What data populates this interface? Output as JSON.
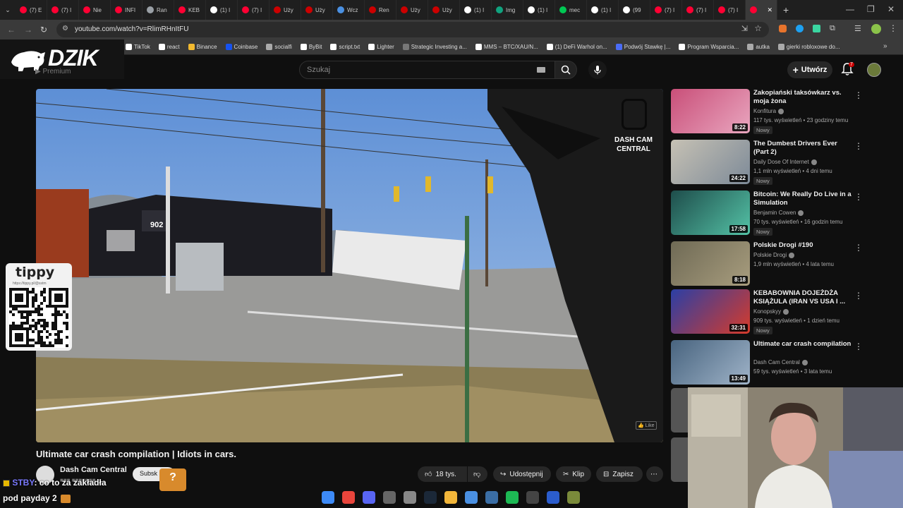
{
  "tabs": [
    {
      "label": "(7) E",
      "color": "#ff0033"
    },
    {
      "label": "(7) I",
      "color": "#ff0033"
    },
    {
      "label": "Nie",
      "color": "#ff0033"
    },
    {
      "label": "INFI",
      "color": "#ff0033"
    },
    {
      "label": "Ran",
      "color": "#9aa0a6"
    },
    {
      "label": "KEB",
      "color": "#ff0033"
    },
    {
      "label": "(1) I",
      "color": "#ffffff"
    },
    {
      "label": "(7) I",
      "color": "#ff0033"
    },
    {
      "label": "Uży",
      "color": "#cc0000"
    },
    {
      "label": "Uży",
      "color": "#cc0000"
    },
    {
      "label": "Wcz",
      "color": "#4a90e2"
    },
    {
      "label": "Ren",
      "color": "#cc0000"
    },
    {
      "label": "Uży",
      "color": "#cc0000"
    },
    {
      "label": "Uży",
      "color": "#cc0000"
    },
    {
      "label": "(1) I",
      "color": "#ffffff"
    },
    {
      "label": "Img",
      "color": "#10a37f"
    },
    {
      "label": "(1) I",
      "color": "#ffffff"
    },
    {
      "label": "mec",
      "color": "#00c853"
    },
    {
      "label": "(1) I",
      "color": "#ffffff"
    },
    {
      "label": "(99",
      "color": "#ffffff"
    },
    {
      "label": "(7) I",
      "color": "#ff0033"
    },
    {
      "label": "(7) I",
      "color": "#ff0033"
    },
    {
      "label": "(7) I",
      "color": "#ff0033"
    },
    {
      "label": "",
      "color": "#ff0033",
      "active": true
    }
  ],
  "address": {
    "url": "youtube.com/watch?v=RlimRHnItFU"
  },
  "bookmarks": [
    {
      "label": "TikTok",
      "color": "#ffffff"
    },
    {
      "label": "react",
      "color": "#ffffff"
    },
    {
      "label": "Binance",
      "color": "#f3ba2f"
    },
    {
      "label": "Coinbase",
      "color": "#1652f0"
    },
    {
      "label": "socialfi",
      "color": "#aaaaaa"
    },
    {
      "label": "ByBit",
      "color": "#ffffff"
    },
    {
      "label": "script.txt",
      "color": "#ffffff"
    },
    {
      "label": "Lighter",
      "color": "#ffffff"
    },
    {
      "label": "Strategic Investing a...",
      "color": "#777777"
    },
    {
      "label": "MMS – BTC/XAU/N...",
      "color": "#ffffff"
    },
    {
      "label": "(1) DeFi Warhol on...",
      "color": "#ffffff"
    },
    {
      "label": "Podwój Stawkę |...",
      "color": "#4a6cf7"
    },
    {
      "label": "Program Wsparcia...",
      "color": "#ffffff"
    },
    {
      "label": "autka",
      "color": "#aaaaaa"
    },
    {
      "label": "gierki robloxowe do...",
      "color": "#aaaaaa"
    }
  ],
  "logo": {
    "text": "DZIK"
  },
  "header": {
    "search_placeholder": "Szukaj",
    "create_label": "Utwórz",
    "notif_count": "7"
  },
  "video": {
    "title": "Ultimate car crash compilation | Idiots in cars.",
    "watermark": "DASH CAM CENTRAL",
    "channel": "Dash Cam Central",
    "subscribe": "Subsk",
    "likes": "18 tys.",
    "share": "Udostępnij",
    "clip": "Klip",
    "save": "Zapisz"
  },
  "recommendations": [
    {
      "title": "Zakopiański taksówkarz vs. moja żona",
      "channel": "Konfitura",
      "meta": "117 tys. wyświetleń • 23 godziny temu",
      "new": "Nowy",
      "duration": "8:22"
    },
    {
      "title": "The Dumbest Drivers Ever (Part 2)",
      "channel": "Daily Dose Of Internet",
      "meta": "1,1 mln wyświetleń • 4 dni temu",
      "new": "Nowy",
      "duration": "24:22"
    },
    {
      "title": "Bitcoin: We Really Do Live in a Simulation",
      "channel": "Benjamin Cowen",
      "meta": "70 tys. wyświetleń • 16 godzin temu",
      "new": "Nowy",
      "duration": "17:58"
    },
    {
      "title": "Polskie Drogi #190",
      "channel": "Polskie Drogi",
      "meta": "1,9 mln wyświetleń • 4 lata temu",
      "new": "",
      "duration": "8:18"
    },
    {
      "title": "KEBABOWNIA DOJEŻDŻA KSIĄŻULA (IRAN VS USA I ...",
      "channel": "Konopskyy",
      "meta": "909 tys. wyświetleń • 1 dzień temu",
      "new": "Nowy",
      "duration": "32:31"
    },
    {
      "title": "Ultimate car crash compilation",
      "channel": "Dash Cam Central",
      "meta": "59 tys. wyświetleń • 3 lata temu",
      "new": "",
      "duration": "13:49"
    }
  ],
  "overlay": {
    "tippy_title": "tippy",
    "tippy_url": "https://tippy.pl/@sstm",
    "chat_user": "STBY",
    "chat_text": ": co to za zakładła",
    "chat_line2": "pod payday 2"
  },
  "taskbar": [
    {
      "name": "windows-start-icon",
      "color": "#3d8af7"
    },
    {
      "name": "chrome-icon",
      "color": "#e8453c"
    },
    {
      "name": "discord-icon",
      "color": "#5865f2"
    },
    {
      "name": "app-icon",
      "color": "#666666"
    },
    {
      "name": "app2-icon",
      "color": "#888888"
    },
    {
      "name": "steam-icon",
      "color": "#1b2838"
    },
    {
      "name": "files-icon",
      "color": "#f2b63a"
    },
    {
      "name": "refresh-icon",
      "color": "#4a90e2"
    },
    {
      "name": "tool-icon",
      "color": "#3b6ea5"
    },
    {
      "name": "spotify-icon",
      "color": "#1db954"
    },
    {
      "name": "media-icon",
      "color": "#444444"
    },
    {
      "name": "x-icon",
      "color": "#2b5dcd"
    },
    {
      "name": "game-icon",
      "color": "#7a8a3a"
    }
  ]
}
